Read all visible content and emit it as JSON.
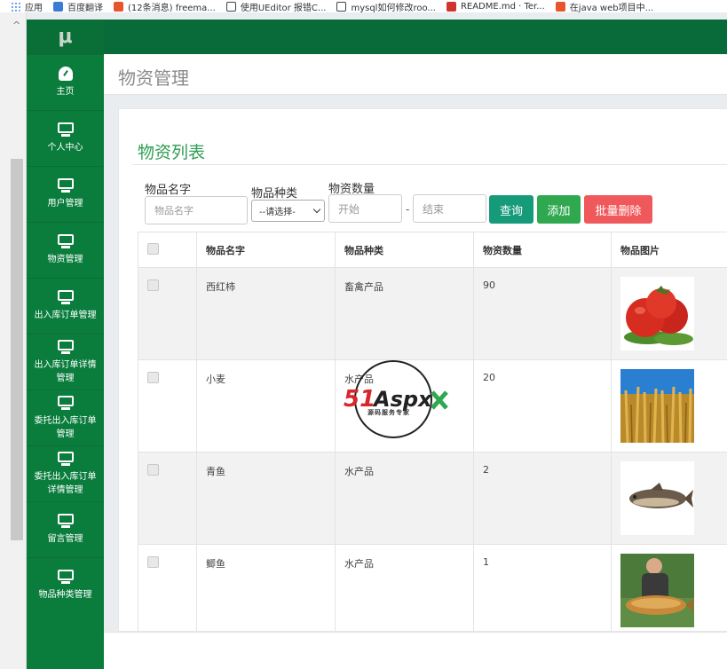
{
  "bookmarks": [
    {
      "label": "应用",
      "icon": "apps-grid-icon",
      "color": "#4285f4"
    },
    {
      "label": "百度翻译",
      "icon": "baidu-translate-icon",
      "color": "#3a7bd5"
    },
    {
      "label": "(12条消息) freema...",
      "icon": "csdn-icon",
      "color": "#e8552d"
    },
    {
      "label": "使用UEditor 报错C...",
      "icon": "vue-icon",
      "color": "#444444"
    },
    {
      "label": "mysql如何修改roo...",
      "icon": "vue-icon",
      "color": "#444444"
    },
    {
      "label": "README.md · Ter...",
      "icon": "gitee-icon",
      "color": "#d0342c"
    },
    {
      "label": "在java web项目中...",
      "icon": "csdn-icon",
      "color": "#e8552d"
    }
  ],
  "brand": {
    "logo": "μ"
  },
  "sidebar": {
    "items": [
      {
        "label": "主页",
        "icon": "dashboard-icon"
      },
      {
        "label": "个人中心",
        "icon": "monitor-icon"
      },
      {
        "label": "用户管理",
        "icon": "monitor-icon"
      },
      {
        "label": "物资管理",
        "icon": "monitor-icon"
      },
      {
        "label": "出入库订单管理",
        "icon": "monitor-icon"
      },
      {
        "label": "出入库订单详情管理",
        "icon": "monitor-icon"
      },
      {
        "label": "委托出入库订单管理",
        "icon": "monitor-icon"
      },
      {
        "label": "委托出入库订单详情管理",
        "icon": "monitor-icon"
      },
      {
        "label": "留言管理",
        "icon": "monitor-icon"
      },
      {
        "label": "物品种类管理",
        "icon": "monitor-icon"
      }
    ]
  },
  "page": {
    "title": "物资管理"
  },
  "card": {
    "title": "物资列表"
  },
  "filters": {
    "name_label": "物品名字",
    "name_placeholder": "物品名字",
    "type_label": "物品种类",
    "type_selected": "--请选择-",
    "qty_label": "物资数量",
    "qty_from_placeholder": "开始",
    "qty_sep": "-",
    "qty_to_placeholder": "结束"
  },
  "buttons": {
    "query": "查询",
    "add": "添加",
    "batch_delete": "批量删除"
  },
  "table": {
    "headers": [
      "物品名字",
      "物品种类",
      "物资数量",
      "物品图片"
    ],
    "rows": [
      {
        "name": "西红柿",
        "type": "畜禽产品",
        "qty": "90",
        "image": "tomato"
      },
      {
        "name": "小麦",
        "type": "水产品",
        "qty": "20",
        "image": "wheat"
      },
      {
        "name": "青鱼",
        "type": "水产品",
        "qty": "2",
        "image": "fish"
      },
      {
        "name": "鲫鱼",
        "type": "水产品",
        "qty": "1",
        "image": "carp"
      }
    ]
  },
  "watermark": {
    "brand": "51Aspx",
    "tagline": "源码服务专家"
  },
  "colors": {
    "sidebar": "#0a7d3d",
    "accent": "#2e9e55",
    "danger": "#f0595c"
  }
}
